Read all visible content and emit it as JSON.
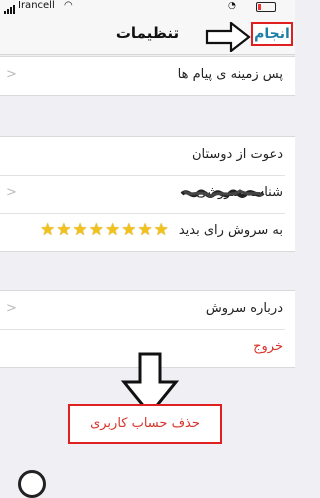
{
  "status_bar": {
    "carrier": "Irancell"
  },
  "nav": {
    "title": "تنظیمات",
    "done_label": "انجام"
  },
  "settings": {
    "background_label": "پس زمینه ی پیام ها",
    "invite_label": "دعوت از دوستان",
    "soroush_id_label": "شناسه سروشی",
    "rate_label": "به سروش رای بدید",
    "rate_stars": "★★★★★★★★",
    "about_label": "درباره سروش",
    "logout_label": "خروج",
    "delete_account_label": "حذف حساب کاربری"
  },
  "colors": {
    "accent": "#1e7fa6",
    "destructive": "#d9342b",
    "highlight_box": "#e02020",
    "star": "#f2c21b"
  },
  "icons": [
    "signal-bars-icon",
    "wifi-icon",
    "battery-icon",
    "chevron-left-icon",
    "arrow-right-icon",
    "arrow-down-icon"
  ]
}
